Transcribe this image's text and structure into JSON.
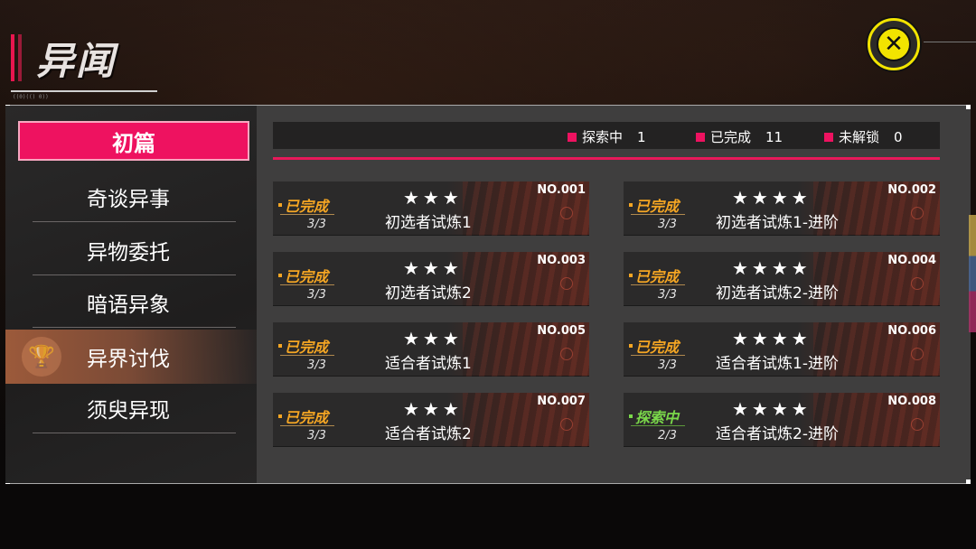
{
  "header": {
    "title": "异闻",
    "subtitle": "((0)(() 0))"
  },
  "close": {
    "icon": "close-icon",
    "glyph": "✕"
  },
  "sidebar": {
    "category": "初篇",
    "items": [
      {
        "label": "奇谈异事"
      },
      {
        "label": "异物委托"
      },
      {
        "label": "暗语异象"
      },
      {
        "label": "异界讨伐",
        "selected": true,
        "icon": "trophy-icon"
      },
      {
        "label": "须臾异现"
      }
    ]
  },
  "status": {
    "exploring_label": "探索中",
    "exploring_count": "1",
    "done_label": "已完成",
    "done_count": "11",
    "locked_label": "未解锁",
    "locked_count": "0"
  },
  "cards": [
    {
      "no": "NO.001",
      "state": "已完成",
      "progress": "3/3",
      "stars": "★★★",
      "name": "初选者试炼1"
    },
    {
      "no": "NO.002",
      "state": "已完成",
      "progress": "3/3",
      "stars": "★★★★",
      "name": "初选者试炼1-进阶"
    },
    {
      "no": "NO.003",
      "state": "已完成",
      "progress": "3/3",
      "stars": "★★★",
      "name": "初选者试炼2"
    },
    {
      "no": "NO.004",
      "state": "已完成",
      "progress": "3/3",
      "stars": "★★★★",
      "name": "初选者试炼2-进阶"
    },
    {
      "no": "NO.005",
      "state": "已完成",
      "progress": "3/3",
      "stars": "★★★",
      "name": "适合者试炼1"
    },
    {
      "no": "NO.006",
      "state": "已完成",
      "progress": "3/3",
      "stars": "★★★★",
      "name": "适合者试炼1-进阶"
    },
    {
      "no": "NO.007",
      "state": "已完成",
      "progress": "3/3",
      "stars": "★★★",
      "name": "适合者试炼2"
    },
    {
      "no": "NO.008",
      "state": "探索中",
      "progress": "2/3",
      "stars": "★★★★",
      "name": "适合者试炼2-进阶"
    }
  ],
  "colors": {
    "accent": "#ee1260",
    "done": "#f5a623",
    "exploring": "#7ad84a",
    "close_ring": "#f2e400"
  }
}
